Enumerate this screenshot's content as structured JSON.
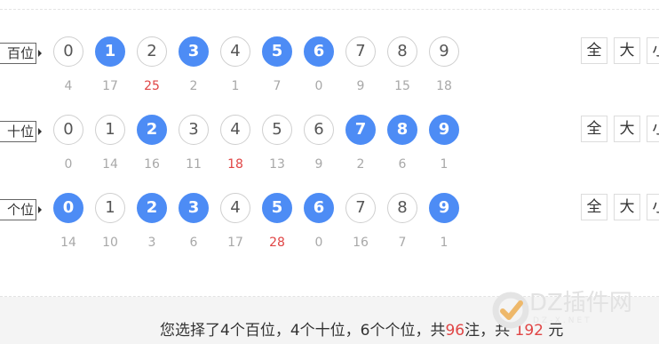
{
  "rows": [
    {
      "label": "百位",
      "balls": [
        {
          "n": "0",
          "on": false
        },
        {
          "n": "1",
          "on": true
        },
        {
          "n": "2",
          "on": false
        },
        {
          "n": "3",
          "on": true
        },
        {
          "n": "4",
          "on": false
        },
        {
          "n": "5",
          "on": true
        },
        {
          "n": "6",
          "on": true
        },
        {
          "n": "7",
          "on": false
        },
        {
          "n": "8",
          "on": false
        },
        {
          "n": "9",
          "on": false
        }
      ],
      "miss": [
        "4",
        "17",
        "25",
        "2",
        "1",
        "7",
        "0",
        "9",
        "15",
        "18"
      ],
      "hot_index": 2,
      "quick": [
        "全",
        "大",
        "小"
      ]
    },
    {
      "label": "十位",
      "balls": [
        {
          "n": "0",
          "on": false
        },
        {
          "n": "1",
          "on": false
        },
        {
          "n": "2",
          "on": true
        },
        {
          "n": "3",
          "on": false
        },
        {
          "n": "4",
          "on": false
        },
        {
          "n": "5",
          "on": false
        },
        {
          "n": "6",
          "on": false
        },
        {
          "n": "7",
          "on": true
        },
        {
          "n": "8",
          "on": true
        },
        {
          "n": "9",
          "on": true
        }
      ],
      "miss": [
        "0",
        "14",
        "16",
        "11",
        "18",
        "13",
        "9",
        "2",
        "6",
        "1"
      ],
      "hot_index": 4,
      "quick": [
        "全",
        "大",
        "小"
      ]
    },
    {
      "label": "个位",
      "balls": [
        {
          "n": "0",
          "on": true
        },
        {
          "n": "1",
          "on": false
        },
        {
          "n": "2",
          "on": true
        },
        {
          "n": "3",
          "on": true
        },
        {
          "n": "4",
          "on": false
        },
        {
          "n": "5",
          "on": true
        },
        {
          "n": "6",
          "on": true
        },
        {
          "n": "7",
          "on": false
        },
        {
          "n": "8",
          "on": false
        },
        {
          "n": "9",
          "on": true
        }
      ],
      "miss": [
        "14",
        "10",
        "3",
        "6",
        "17",
        "28",
        "0",
        "16",
        "7",
        "1"
      ],
      "hot_index": 5,
      "quick": [
        "全",
        "大",
        "小"
      ]
    }
  ],
  "summary": {
    "prefix": "您选择了4个百位，4个十位，6个个位，共",
    "bets": "96",
    "middle": "注，共",
    "amount": "192",
    "suffix": "元"
  },
  "watermark": {
    "text": "DZ插件网",
    "sub": "DZ-X.NET"
  },
  "colors": {
    "selected": "#4d8cf5",
    "hot": "#e04545",
    "miss": "#a8a8a8"
  }
}
